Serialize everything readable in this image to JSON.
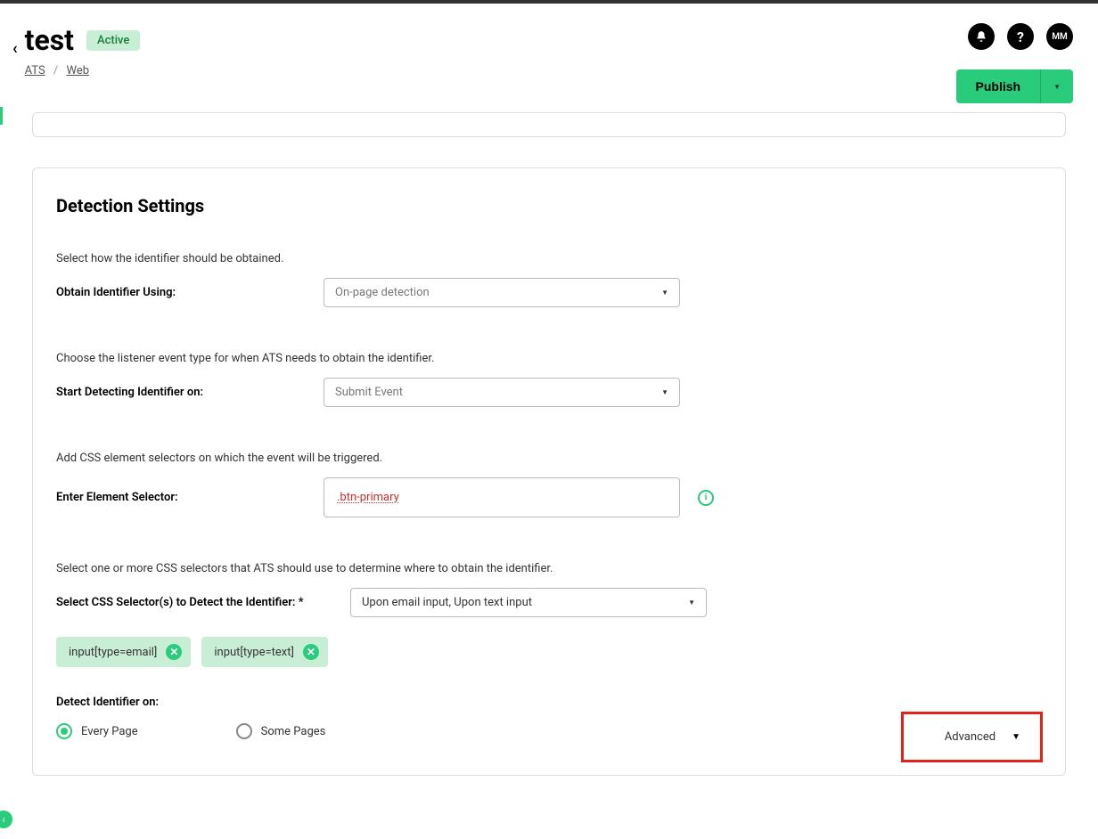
{
  "header": {
    "title": "test",
    "status": "Active",
    "breadcrumb": {
      "item1": "ATS",
      "item2": "Web"
    },
    "avatar_initials": "MM",
    "publish_label": "Publish"
  },
  "section": {
    "title": "Detection Settings",
    "help1": "Select how the identifier should be obtained.",
    "field1_label": "Obtain Identifier Using:",
    "field1_value": "On-page detection",
    "help2": "Choose the listener event type for when ATS needs to obtain the identifier.",
    "field2_label": "Start Detecting Identifier on:",
    "field2_value": "Submit Event",
    "help3": "Add CSS element selectors on which the event will be triggered.",
    "field3_label": "Enter Element Selector:",
    "field3_value": ".btn-primary",
    "help4": "Select one or more CSS selectors that ATS should use to determine where to obtain the identifier.",
    "field4_label": "Select CSS Selector(s) to Detect the Identifier: *",
    "field4_value": "Upon email input, Upon text input",
    "chip1": "input[type=email]",
    "chip2": "input[type=text]",
    "detect_on_label": "Detect Identifier on:",
    "radio1": "Every Page",
    "radio2": "Some Pages",
    "advanced_label": "Advanced"
  }
}
